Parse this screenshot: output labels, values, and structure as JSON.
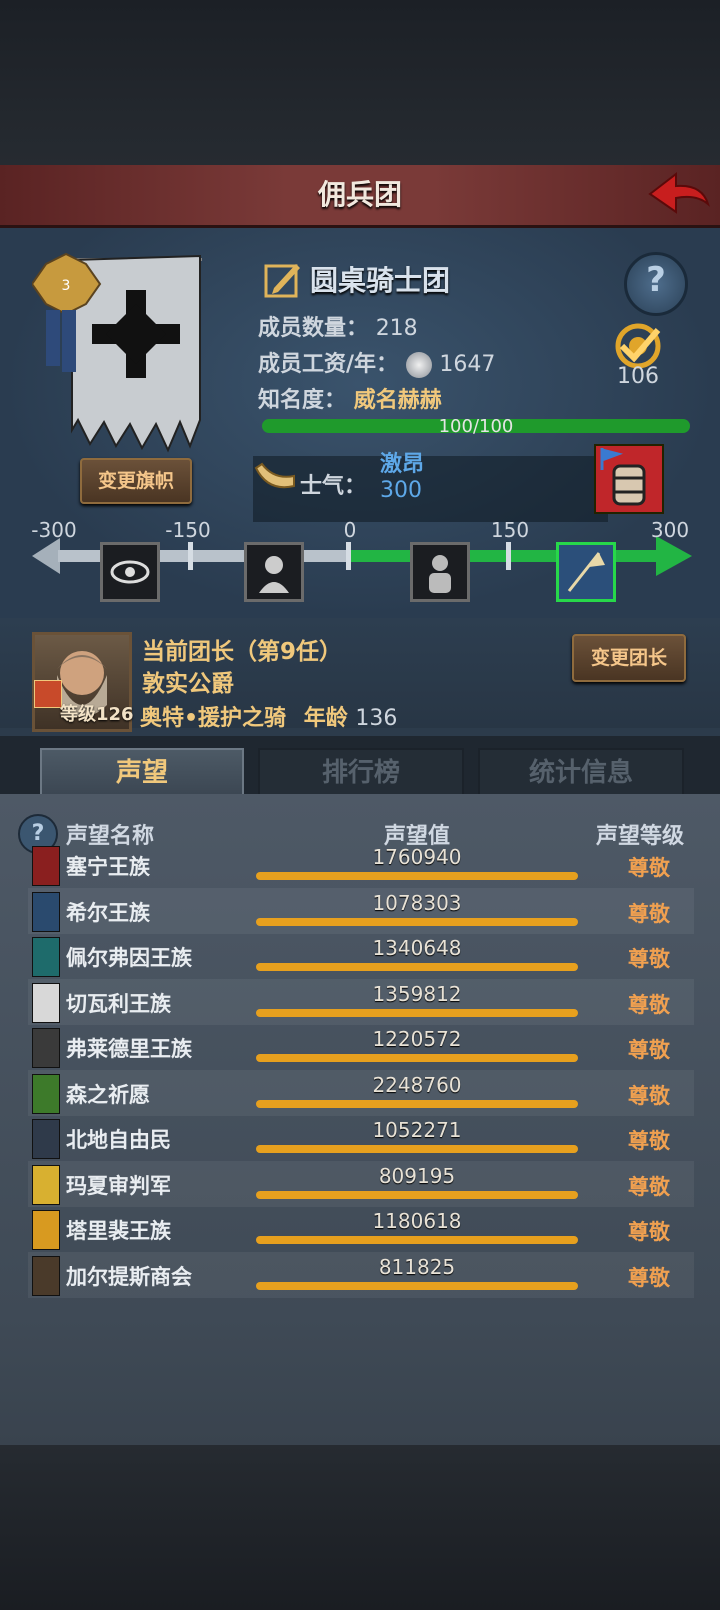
{
  "title": "佣兵团",
  "guild": {
    "name": "圆桌骑士团",
    "members_label": "成员数量：",
    "members": "218",
    "salary_label": "成员工资/年：",
    "salary": "1647",
    "fame_label": "知名度：",
    "fame_value": "威名赫赫",
    "fame_progress_text": "100/100",
    "fame_progress": 1.0,
    "badge_count": "106",
    "change_banner": "变更旗帜"
  },
  "morale": {
    "label": "士气：",
    "state": "激昂",
    "value": "300",
    "scale_ticks": [
      "-300",
      "-150",
      "0",
      "150",
      "300"
    ]
  },
  "leader": {
    "title": "当前团长（第9任）",
    "honor": "敦实公爵",
    "name": "奥特•援护之骑",
    "age_label": "年龄",
    "age": "136",
    "level_label": "等级",
    "level": "126",
    "change_leader": "变更团长"
  },
  "tabs": [
    "声望",
    "排行榜",
    "统计信息"
  ],
  "reputation": {
    "headers": [
      "声望名称",
      "声望值",
      "声望等级"
    ],
    "rows": [
      {
        "name": "塞宁王族",
        "value": "1760940",
        "level": "尊敬",
        "color": "#8a1f1f"
      },
      {
        "name": "希尔王族",
        "value": "1078303",
        "level": "尊敬",
        "color": "#2a4a6e"
      },
      {
        "name": "佩尔弗因王族",
        "value": "1340648",
        "level": "尊敬",
        "color": "#1e6b6b"
      },
      {
        "name": "切瓦利王族",
        "value": "1359812",
        "level": "尊敬",
        "color": "#d8d8d8"
      },
      {
        "name": "弗莱德里王族",
        "value": "1220572",
        "level": "尊敬",
        "color": "#3a3a3a"
      },
      {
        "name": "森之祈愿",
        "value": "2248760",
        "level": "尊敬",
        "color": "#3d7a2a"
      },
      {
        "name": "北地自由民",
        "value": "1052271",
        "level": "尊敬",
        "color": "#2f3a4a"
      },
      {
        "name": "玛夏审判军",
        "value": "809195",
        "level": "尊敬",
        "color": "#d8b030"
      },
      {
        "name": "塔里裴王族",
        "value": "1180618",
        "level": "尊敬",
        "color": "#d89a20"
      },
      {
        "name": "加尔提斯商会",
        "value": "811825",
        "level": "尊敬",
        "color": "#4a3a2a"
      }
    ]
  },
  "colors": {
    "accent_gold": "#f0c87c",
    "rep_bar": "#e7a01e",
    "fame_bar": "#1f9a2c"
  }
}
